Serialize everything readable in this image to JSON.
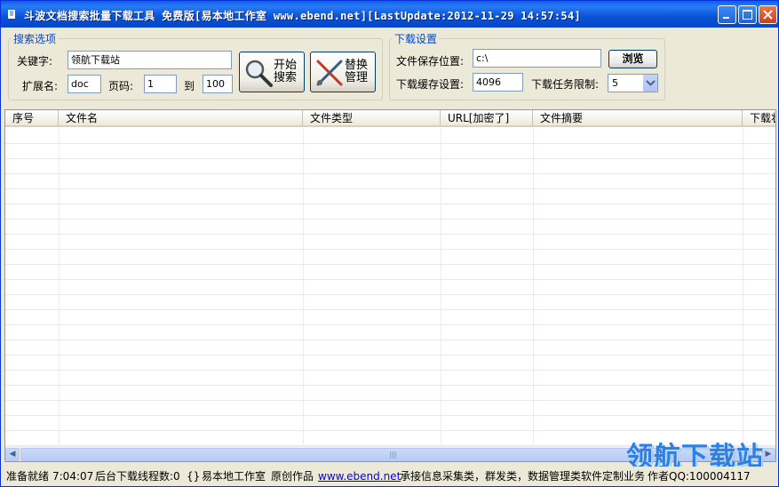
{
  "window": {
    "title": "斗波文档搜索批量下载工具 免费版[易本地工作室 www.ebend.net][LastUpdate:2012-11-29 14:57:54]"
  },
  "search_options": {
    "legend": "搜索选项",
    "keyword_label": "关键字:",
    "keyword_value": "领航下载站",
    "ext_label": "扩展名:",
    "ext_value": "doc",
    "page_label": "页码:",
    "page_from": "1",
    "to_label": "到",
    "page_to": "100",
    "start_search_label": "开始\n搜索",
    "replace_manage_label": "替换\n管理"
  },
  "download_settings": {
    "legend": "下载设置",
    "save_path_label": "文件保存位置:",
    "save_path_value": "c:\\",
    "browse_label": "浏览",
    "cache_label": "下载缓存设置:",
    "cache_value": "4096",
    "task_limit_label": "下载任务限制:",
    "task_limit_value": "5"
  },
  "table": {
    "columns": [
      "序号",
      "文件名",
      "文件类型",
      "URL[加密了]",
      "文件摘要",
      "下载状"
    ]
  },
  "status": {
    "ready": "准备就绪",
    "time": "7:04:07",
    "threads": "后台下载线程数:0",
    "braces": "{}",
    "studio": "易本地工作室",
    "original": "原创作品",
    "link": "www.ebend.net",
    "services": "承接信息采集类，群发类，数据管理类软件定制业务",
    "author": "作者QQ:100004117"
  },
  "watermark": "领航下载站"
}
